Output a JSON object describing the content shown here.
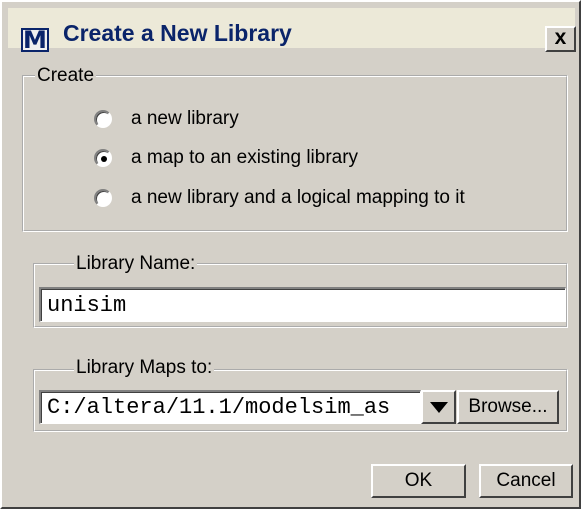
{
  "window": {
    "title": "Create a New Library",
    "app_icon_glyph": "M",
    "close_glyph": "x"
  },
  "create_group": {
    "label": "Create",
    "options": [
      {
        "label": "a new library",
        "selected": false
      },
      {
        "label": "a map to an existing library",
        "selected": true
      },
      {
        "label": "a new library and a logical mapping to it",
        "selected": false
      }
    ]
  },
  "library_name": {
    "label": "Library Name:",
    "value": "unisim"
  },
  "library_maps_to": {
    "label": "Library Maps to:",
    "value": "C:/altera/11.1/modelsim_as",
    "browse_label": "Browse..."
  },
  "buttons": {
    "ok_label": "OK",
    "cancel_label": "Cancel"
  },
  "colors": {
    "title_text": "#0a246a",
    "dialog_background": "#d4d0c8"
  },
  "icons": {
    "app": "modelsim-app-icon",
    "close": "close-icon",
    "dropdown": "chevron-down-icon"
  }
}
